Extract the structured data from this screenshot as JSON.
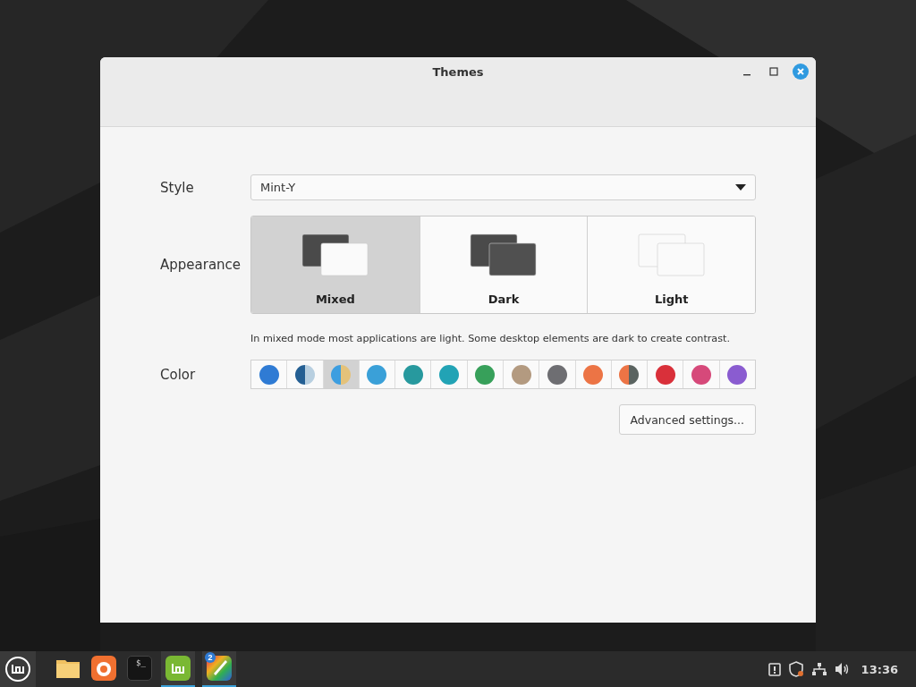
{
  "window": {
    "title": "Themes"
  },
  "style": {
    "label": "Style",
    "value": "Mint-Y"
  },
  "appearance": {
    "label": "Appearance",
    "options": [
      {
        "label": "Mixed",
        "kind": "mixed",
        "selected": true
      },
      {
        "label": "Dark",
        "kind": "dark",
        "selected": false
      },
      {
        "label": "Light",
        "kind": "light",
        "selected": false
      }
    ],
    "description": "In mixed mode most applications are light. Some desktop elements are dark to create contrast."
  },
  "color": {
    "label": "Color",
    "swatches": [
      {
        "color": "#2f7bd4",
        "selected": false
      },
      {
        "kind": "split",
        "halves": [
          {
            "color": "#245f93"
          },
          {
            "color": "#b8cfe0"
          }
        ],
        "selected": false
      },
      {
        "kind": "split",
        "halves": [
          {
            "color": "#3d9ee0"
          },
          {
            "color": "#e4c27a"
          }
        ],
        "selected": true
      },
      {
        "color": "#3aa0d8",
        "selected": false
      },
      {
        "color": "#27999e",
        "selected": false
      },
      {
        "color": "#22a3b5",
        "selected": false
      },
      {
        "color": "#37a05a",
        "selected": false
      },
      {
        "color": "#b39a80",
        "selected": false
      },
      {
        "color": "#6e6e72",
        "selected": false
      },
      {
        "color": "#ec7445",
        "selected": false
      },
      {
        "kind": "split",
        "halves": [
          {
            "color": "#ec7445"
          },
          {
            "color": "#5a6360"
          }
        ],
        "selected": false
      },
      {
        "color": "#d9303a",
        "selected": false
      },
      {
        "color": "#d6497a",
        "selected": false
      },
      {
        "color": "#8a5cd0",
        "selected": false
      }
    ]
  },
  "advanced_button": "Advanced settings...",
  "taskbar": {
    "launchers": [
      {
        "kind": "folder",
        "running": false
      },
      {
        "kind": "browser",
        "running": false
      },
      {
        "kind": "terminal",
        "glyph": "$_",
        "running": false
      },
      {
        "kind": "mint",
        "running": true
      },
      {
        "kind": "paint",
        "badge": "2",
        "running": true
      }
    ],
    "clock": "13:36"
  }
}
